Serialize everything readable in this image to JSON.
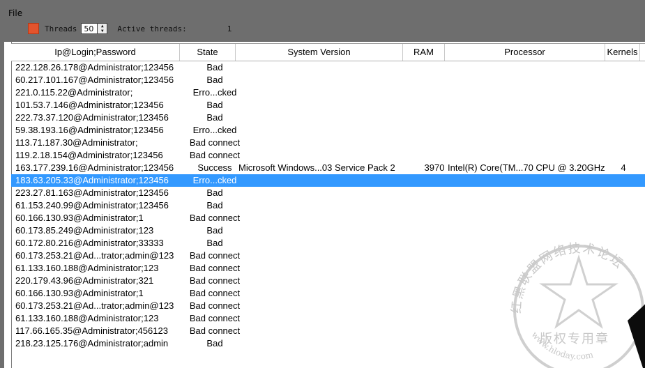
{
  "menu": {
    "file": "File"
  },
  "toolbar": {
    "threads_label": "Threads",
    "threads_value": "50",
    "active_label": "Active threads:",
    "active_value": "1"
  },
  "columns": [
    "Ip@Login;Password",
    "State",
    "System Version",
    "RAM",
    "Processor",
    "Kernels"
  ],
  "rows": [
    [
      "222.128.26.178@Administrator;123456",
      "Bad",
      "",
      "",
      "",
      ""
    ],
    [
      "60.217.101.167@Administrator;123456",
      "Bad",
      "",
      "",
      "",
      ""
    ],
    [
      "221.0.115.22@Administrator;",
      "Erro...cked",
      "",
      "",
      "",
      ""
    ],
    [
      "101.53.7.146@Administrator;123456",
      "Bad",
      "",
      "",
      "",
      ""
    ],
    [
      "222.73.37.120@Administrator;123456",
      "Bad",
      "",
      "",
      "",
      ""
    ],
    [
      "59.38.193.16@Administrator;123456",
      "Erro...cked",
      "",
      "",
      "",
      ""
    ],
    [
      "113.71.187.30@Administrator;",
      "Bad connect",
      "",
      "",
      "",
      ""
    ],
    [
      "119.2.18.154@Administrator;123456",
      "Bad connect",
      "",
      "",
      "",
      ""
    ],
    [
      "163.177.239.16@Administrator;123456",
      "Success",
      "Microsoft Windows...03 Service Pack 2",
      "3970",
      "Intel(R) Core(TM...70 CPU @ 3.20GHz",
      "4"
    ],
    [
      "183.63.205.33@Administrator;123456",
      "Erro...cked",
      "",
      "",
      "",
      ""
    ],
    [
      "223.27.81.163@Administrator;123456",
      "Bad",
      "",
      "",
      "",
      ""
    ],
    [
      "61.153.240.99@Administrator;123456",
      "Bad",
      "",
      "",
      "",
      ""
    ],
    [
      "60.166.130.93@Administrator;1",
      "Bad connect",
      "",
      "",
      "",
      ""
    ],
    [
      "60.173.85.249@Administrator;123",
      "Bad",
      "",
      "",
      "",
      ""
    ],
    [
      "60.172.80.216@Administrator;33333",
      "Bad",
      "",
      "",
      "",
      ""
    ],
    [
      "60.173.253.21@Ad...trator;admin@123",
      "Bad connect",
      "",
      "",
      "",
      ""
    ],
    [
      "61.133.160.188@Administrator;123",
      "Bad connect",
      "",
      "",
      "",
      ""
    ],
    [
      "220.179.43.96@Administrator;321",
      "Bad connect",
      "",
      "",
      "",
      ""
    ],
    [
      "60.166.130.93@Administrator;1",
      "Bad connect",
      "",
      "",
      "",
      ""
    ],
    [
      "60.173.253.21@Ad...trator;admin@123",
      "Bad connect",
      "",
      "",
      "",
      ""
    ],
    [
      "61.133.160.188@Administrator;123",
      "Bad connect",
      "",
      "",
      "",
      ""
    ],
    [
      "117.66.165.35@Administrator;456123",
      "Bad connect",
      "",
      "",
      "",
      ""
    ],
    [
      "218.23.125.176@Administrator;admin",
      "Bad",
      "",
      "",
      "",
      ""
    ]
  ],
  "selected_row": 9,
  "watermark": {
    "line1": "红黑联盟网络技术论坛",
    "line2": "版权专用章",
    "line3": "www.hloday.com"
  }
}
